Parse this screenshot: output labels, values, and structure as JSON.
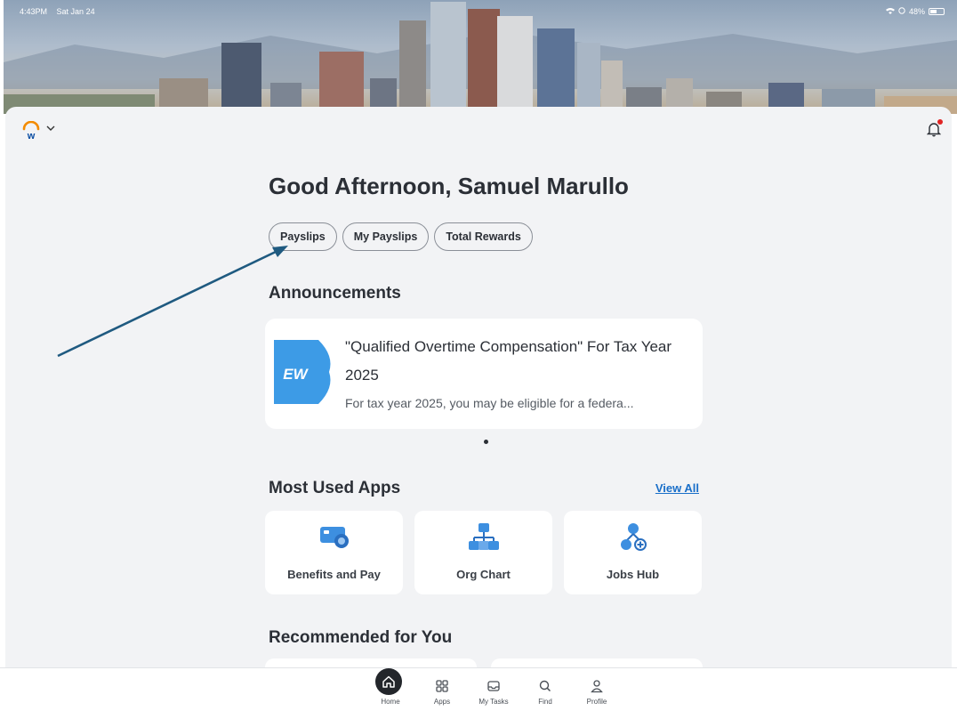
{
  "status_bar": {
    "time": "4:43PM",
    "date": "Sat Jan 24",
    "battery": "48%"
  },
  "header": {
    "app_menu": "workday-logo"
  },
  "greeting": "Good Afternoon, Samuel Marullo",
  "quick_actions": [
    {
      "label": "Payslips"
    },
    {
      "label": "My Payslips"
    },
    {
      "label": "Total Rewards"
    }
  ],
  "announcements": {
    "title": "Announcements",
    "badge_text": "EW",
    "items": [
      {
        "title": "\"Qualified Overtime Compensation\" For Tax Year 2025",
        "body": "For tax year 2025, you may be eligible for a federa..."
      }
    ]
  },
  "most_used_apps": {
    "title": "Most Used Apps",
    "view_all": "View All",
    "apps": [
      {
        "label": "Benefits and Pay",
        "icon": "benefits-pay-icon"
      },
      {
        "label": "Org Chart",
        "icon": "org-chart-icon"
      },
      {
        "label": "Jobs Hub",
        "icon": "jobs-hub-icon"
      }
    ]
  },
  "recommended": {
    "title": "Recommended for You"
  },
  "tab_bar": [
    {
      "label": "Home",
      "icon": "home-icon",
      "active": true
    },
    {
      "label": "Apps",
      "icon": "apps-grid-icon"
    },
    {
      "label": "My Tasks",
      "icon": "inbox-icon"
    },
    {
      "label": "Find",
      "icon": "search-icon"
    },
    {
      "label": "Profile",
      "icon": "profile-icon"
    }
  ],
  "colors": {
    "accent_link": "#1a6fc9",
    "annotation_arrow": "#1f5a80",
    "notification_dot": "#e02424",
    "icon_blue": "#3d8fe0"
  }
}
